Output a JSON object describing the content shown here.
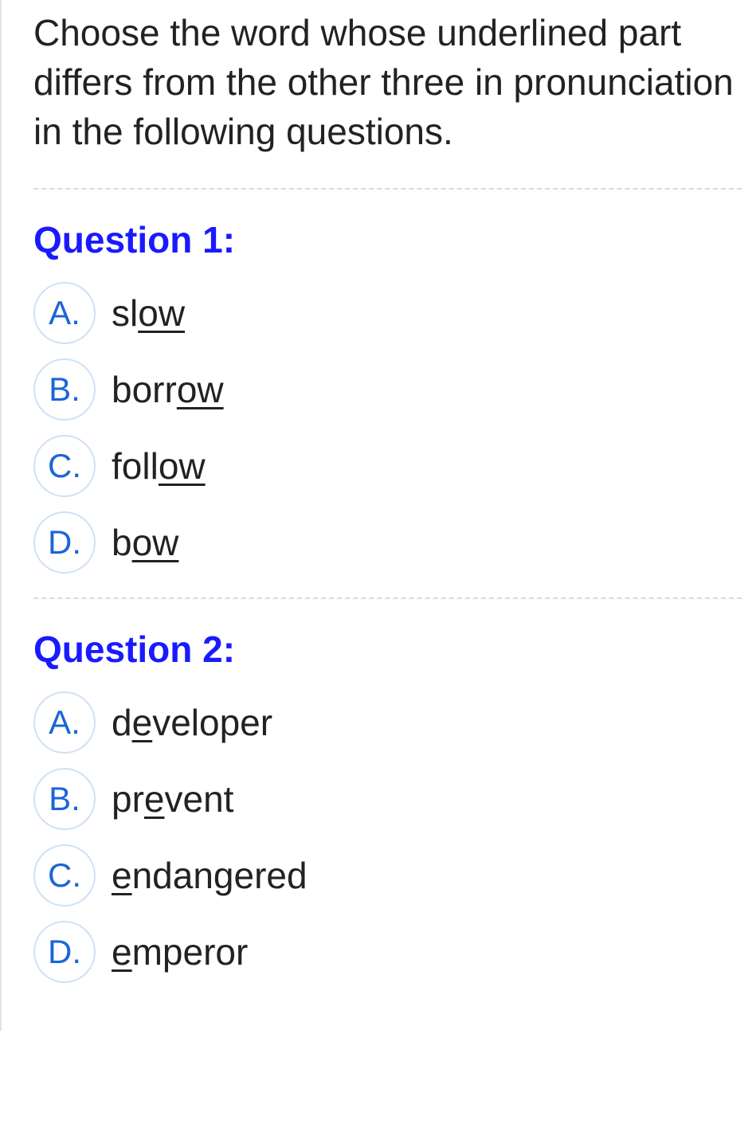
{
  "instructions": "Choose the word whose underlined part differs from the other three in pronunciation in the following questions.",
  "questions": [
    {
      "title": "Question 1:",
      "options": [
        {
          "letter": "A.",
          "pre": "sl",
          "under": "ow",
          "post": ""
        },
        {
          "letter": "B.",
          "pre": "borr",
          "under": "ow",
          "post": ""
        },
        {
          "letter": "C.",
          "pre": "foll",
          "under": "ow",
          "post": ""
        },
        {
          "letter": "D.",
          "pre": "b",
          "under": "ow",
          "post": ""
        }
      ]
    },
    {
      "title": "Question 2:",
      "options": [
        {
          "letter": "A.",
          "pre": "d",
          "under": "e",
          "post": "veloper"
        },
        {
          "letter": "B.",
          "pre": "pr",
          "under": "e",
          "post": "vent"
        },
        {
          "letter": "C.",
          "pre": "",
          "under": "e",
          "post": "ndangered"
        },
        {
          "letter": "D.",
          "pre": "",
          "under": "e",
          "post": "mperor"
        }
      ]
    }
  ]
}
